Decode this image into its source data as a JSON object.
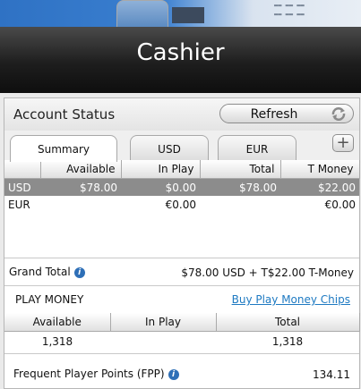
{
  "window": {
    "title": "Cashier"
  },
  "account": {
    "title": "Account Status",
    "refresh_label": "Refresh",
    "tabs": [
      "Summary",
      "USD",
      "EUR"
    ],
    "add_tab": "+"
  },
  "balances": {
    "columns": [
      "",
      "Available",
      "In Play",
      "Total",
      "T Money"
    ],
    "rows": [
      [
        "USD",
        "$78.00",
        "$0.00",
        "$78.00",
        "$22.00"
      ],
      [
        "EUR",
        "",
        "€0.00",
        "",
        "€0.00"
      ]
    ]
  },
  "grand_total": {
    "label": "Grand Total",
    "value": "$78.00 USD + T$22.00 T-Money"
  },
  "play_money": {
    "title": "PLAY MONEY",
    "buy_link": "Buy Play Money Chips",
    "columns": [
      "Available",
      "In Play",
      "Total"
    ],
    "row": [
      "1,318",
      "",
      "1,318"
    ]
  },
  "fpp": {
    "label": "Frequent Player Points (FPP)",
    "value": "134.11"
  },
  "colors": {
    "selected_row": "#8c8c8c",
    "link": "#1e7ac2",
    "info_icon": "#2e6fb7"
  },
  "icons": [
    "refresh-icon",
    "info-icon",
    "plus-icon"
  ]
}
